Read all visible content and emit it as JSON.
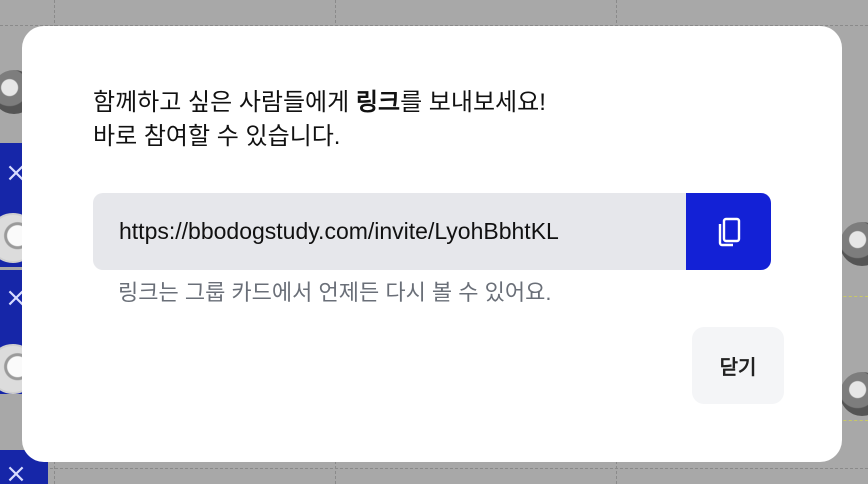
{
  "modal": {
    "message_line1_prefix": "함께하고 싶은 사람들에게 ",
    "message_line1_bold": "링크",
    "message_line1_suffix": "를 보내보세요!",
    "message_line2": "바로 참여할 수 있습니다.",
    "invite_link": "https://bbodogstudy.com/invite/LyohBbhtKL",
    "copy_icon": "copy-icon",
    "hint": "링크는 그룹 카드에서 언제든 다시 볼 수 있어요.",
    "close_label": "닫기"
  },
  "colors": {
    "accent": "#1321d6",
    "link_field_bg": "#e6e7eb",
    "hint_text": "#6a6f78",
    "overlay": "#a8a8a8"
  }
}
